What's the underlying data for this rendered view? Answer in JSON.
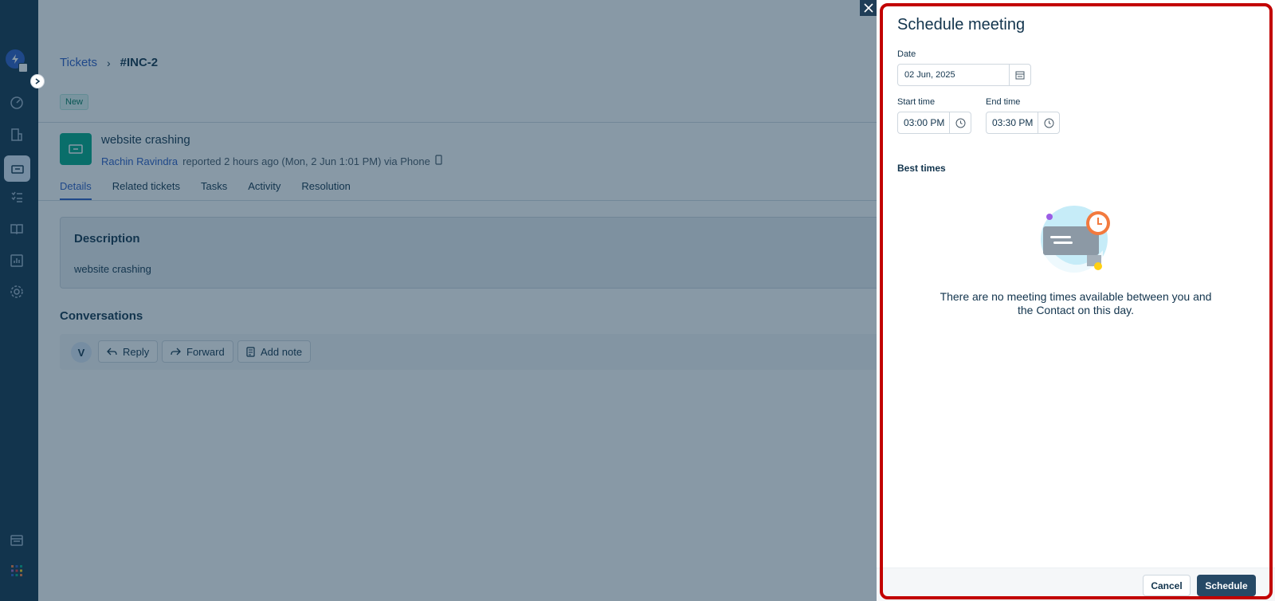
{
  "breadcrumb": {
    "parent": "Tickets",
    "separator": "›",
    "current": "#INC-2"
  },
  "ticket": {
    "status": "New",
    "title": "website crashing",
    "author": "Rachin Ravindra",
    "meta": "reported 2 hours ago (Mon, 2 Jun 1:01 PM) via Phone"
  },
  "tabs": [
    "Details",
    "Related tickets",
    "Tasks",
    "Activity",
    "Resolution"
  ],
  "description": {
    "title": "Description",
    "text": "website crashing"
  },
  "conversations": {
    "title": "Conversations",
    "avatar_initial": "V",
    "reply_label": "Reply",
    "forward_label": "Forward",
    "add_note_label": "Add note"
  },
  "modal": {
    "title": "Schedule meeting",
    "date_label": "Date",
    "date_value": "02 Jun, 2025",
    "start_label": "Start time",
    "start_value": "03:00 PM",
    "end_label": "End time",
    "end_value": "03:30 PM",
    "best_times_label": "Best times",
    "empty_message": "There are no meeting times available between you and the Contact on this day.",
    "cancel_label": "Cancel",
    "schedule_label": "Schedule"
  },
  "icons": {
    "close": "close-icon",
    "calendar": "calendar-icon",
    "clock": "clock-icon",
    "phone": "phone-icon"
  },
  "colors": {
    "sidebar": "#12344d",
    "link": "#2c5cc5",
    "ticket_icon": "#00a886",
    "primary_button": "#264966",
    "highlight_border": "#c20000"
  }
}
